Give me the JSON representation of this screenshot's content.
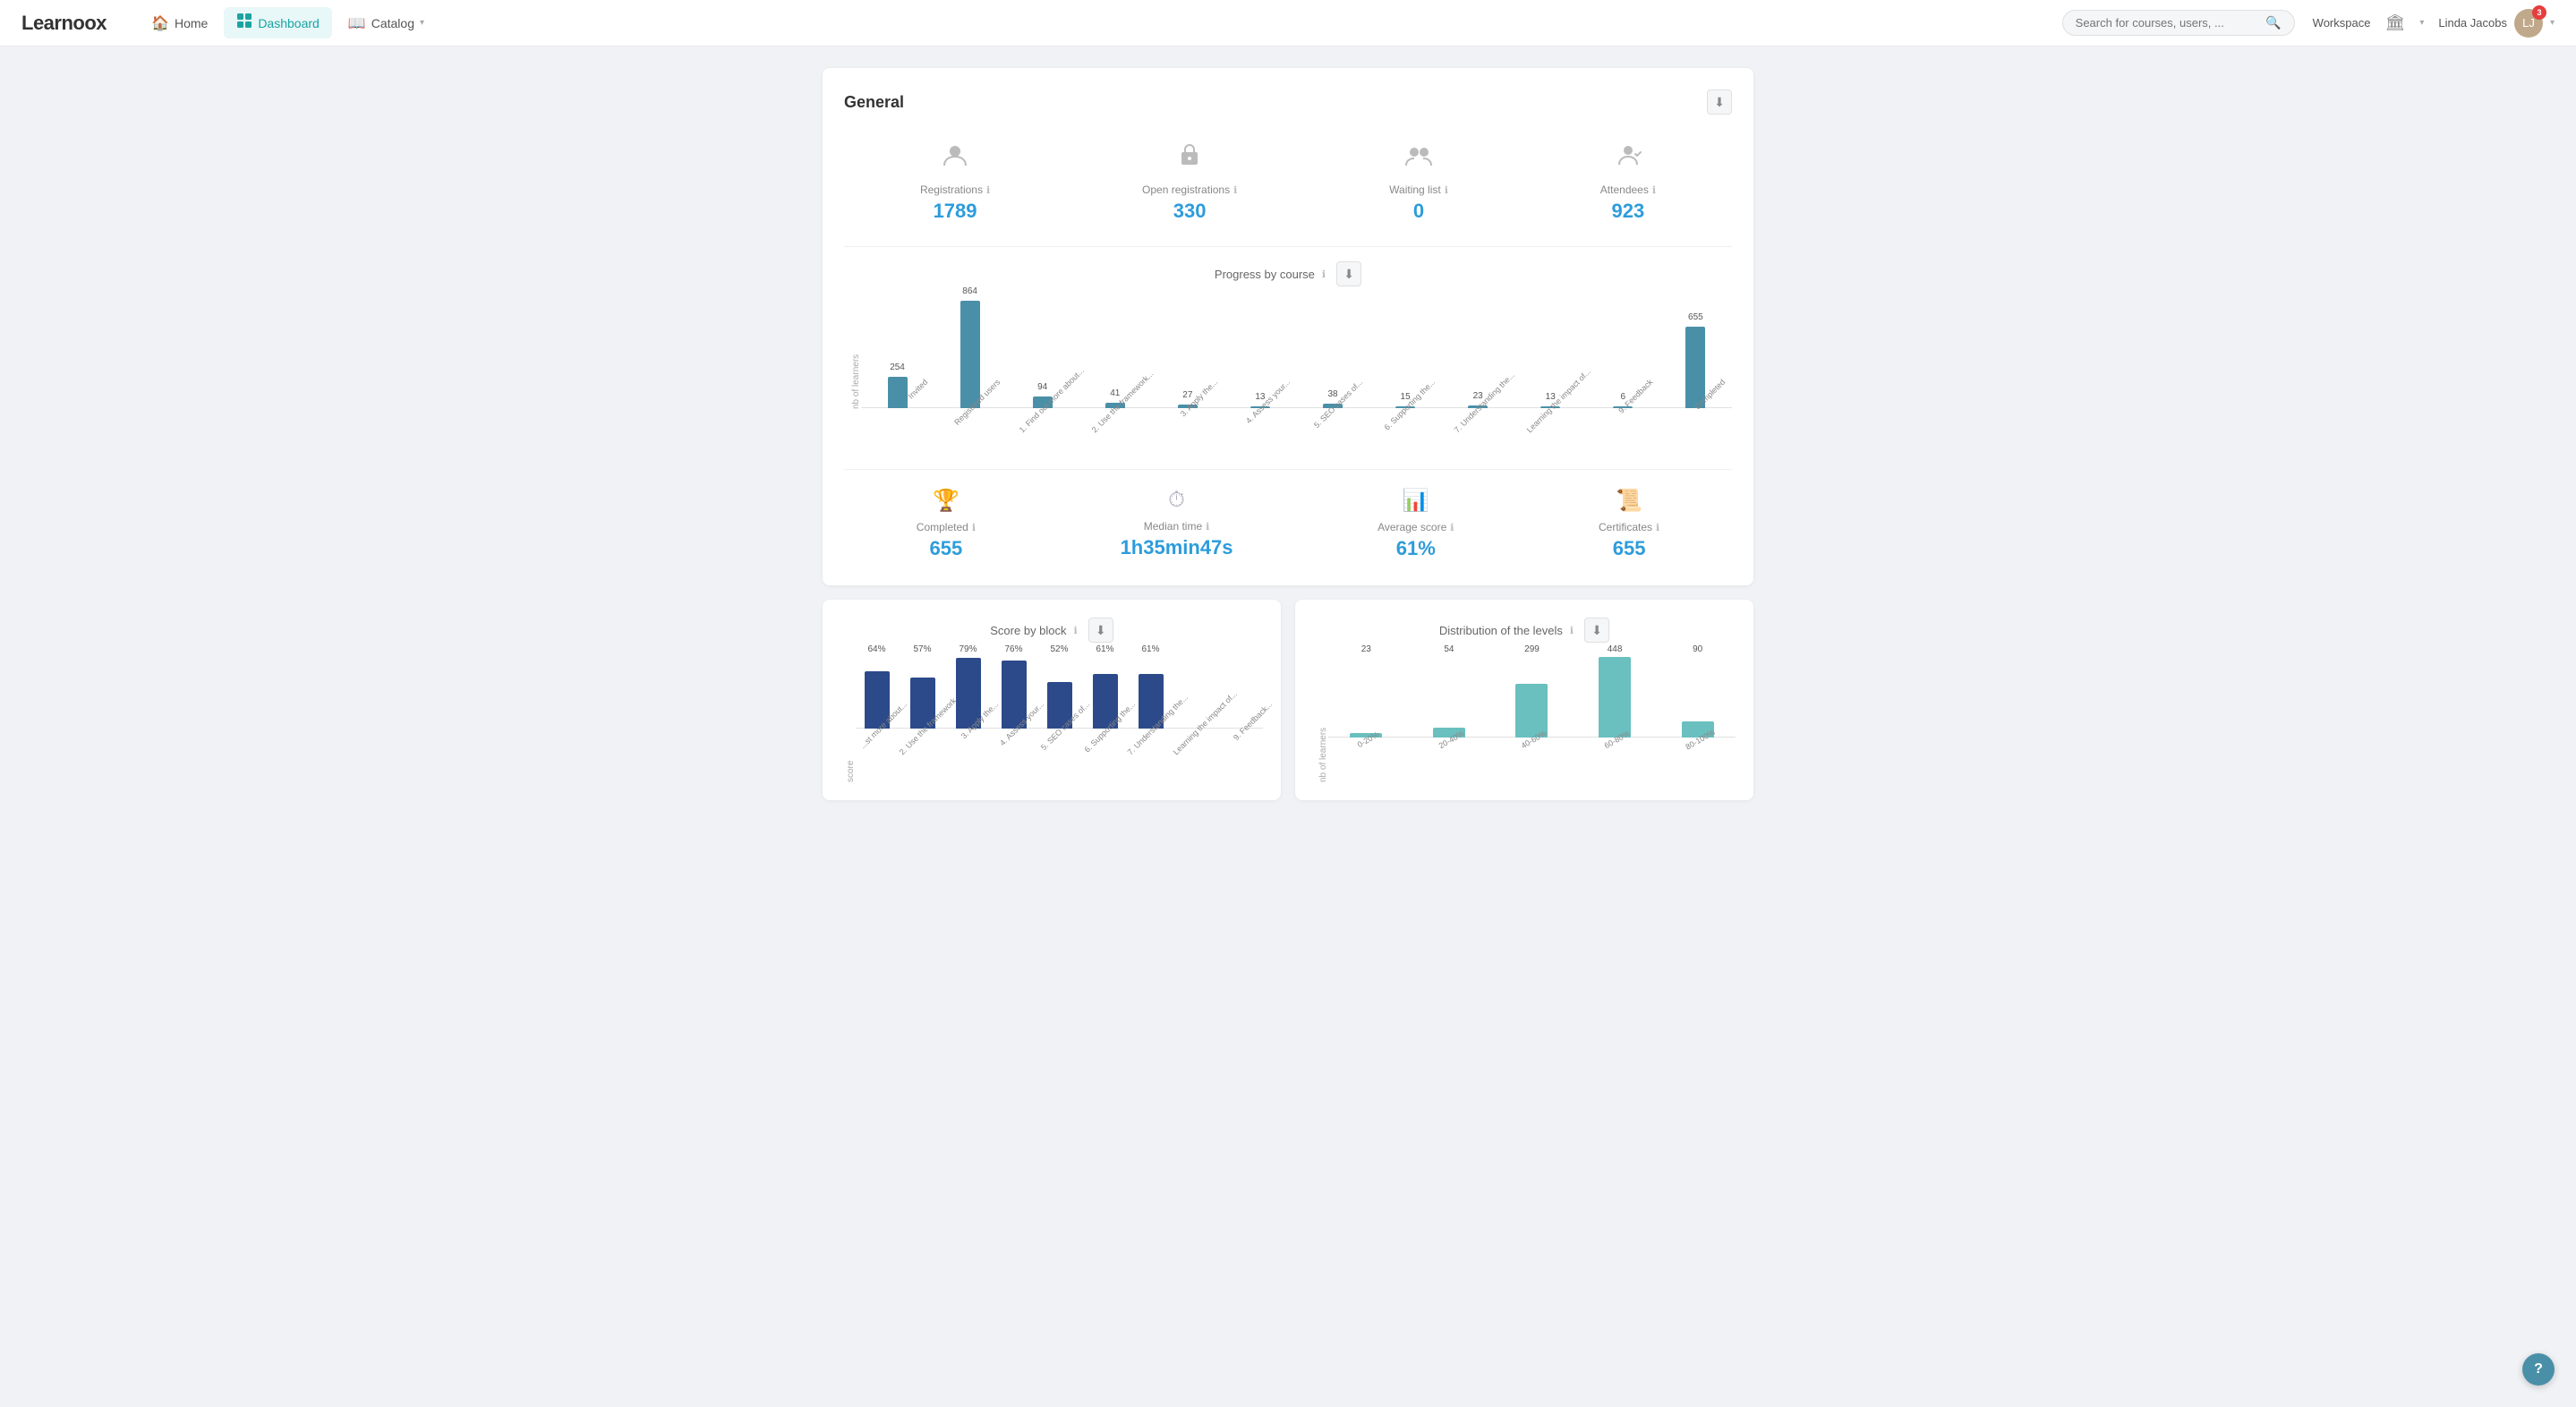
{
  "header": {
    "logo_text": "Learnoox",
    "nav": [
      {
        "label": "Home",
        "icon": "🏠",
        "active": false
      },
      {
        "label": "Dashboard",
        "icon": "📊",
        "active": true
      },
      {
        "label": "Catalog",
        "icon": "📖",
        "active": false
      }
    ],
    "search_placeholder": "Search for courses, users, ...",
    "workspace_label": "Workspace",
    "user_name": "Linda Jacobs",
    "notification_count": "3"
  },
  "general": {
    "title": "General",
    "stats": [
      {
        "icon": "👤",
        "label": "Registrations",
        "value": "1789"
      },
      {
        "icon": "📋",
        "label": "Open registrations",
        "value": "330"
      },
      {
        "icon": "⏳",
        "label": "Waiting list",
        "value": "0"
      },
      {
        "icon": "🎓",
        "label": "Attendees",
        "value": "923"
      }
    ],
    "progress_chart": {
      "title": "Progress by course",
      "y_label": "nb of learners",
      "bars": [
        {
          "label": "Invited",
          "value": 254
        },
        {
          "label": "Registered users",
          "value": 864
        },
        {
          "label": "1. Find out more about...",
          "value": 94
        },
        {
          "label": "2. Use the framework...",
          "value": 41
        },
        {
          "label": "3. Apply the...",
          "value": 27
        },
        {
          "label": "4. Assess your...",
          "value": 13
        },
        {
          "label": "5. SEO cases of...",
          "value": 38
        },
        {
          "label": "6. Supporting the...",
          "value": 15
        },
        {
          "label": "7. Understanding the...",
          "value": 23
        },
        {
          "label": "Learning the impact of...",
          "value": 13
        },
        {
          "label": "9. Feedback",
          "value": 6
        },
        {
          "label": "Completed",
          "value": 655
        }
      ]
    },
    "bottom_stats": [
      {
        "icon": "🏆",
        "label": "Completed",
        "value": "655"
      },
      {
        "icon": "⏰",
        "label": "Median time",
        "value": "1h35min47s"
      },
      {
        "icon": "📈",
        "label": "Average score",
        "value": "61%"
      },
      {
        "icon": "📜",
        "label": "Certificates",
        "value": "655"
      }
    ],
    "score_chart": {
      "title": "Score by block",
      "y_label": "score",
      "bars": [
        {
          "label": "...st more about...",
          "value": 64,
          "pct": "64%"
        },
        {
          "label": "2. Use the framework...",
          "value": 57,
          "pct": "57%"
        },
        {
          "label": "3. Apply the...",
          "value": 79,
          "pct": "79%"
        },
        {
          "label": "4. Assess your...",
          "value": 76,
          "pct": "76%"
        },
        {
          "label": "5. SEO cases of...",
          "value": 52,
          "pct": "52%"
        },
        {
          "label": "6. Supporting the...",
          "value": 61,
          "pct": "61%"
        },
        {
          "label": "7. Understanding the...",
          "value": 61,
          "pct": "61%"
        },
        {
          "label": "Learning the impact of...",
          "value": 0,
          "pct": ""
        },
        {
          "label": "9. Feedback...",
          "value": 0,
          "pct": ""
        }
      ]
    },
    "dist_chart": {
      "title": "Distribution of the levels",
      "y_label": "nb of learners",
      "bars": [
        {
          "label": "0-20%",
          "value": 23
        },
        {
          "label": "20-40%",
          "value": 54
        },
        {
          "label": "40-60%",
          "value": 299
        },
        {
          "label": "60-80%",
          "value": 448
        },
        {
          "label": "80-100%",
          "value": 90
        }
      ]
    }
  }
}
